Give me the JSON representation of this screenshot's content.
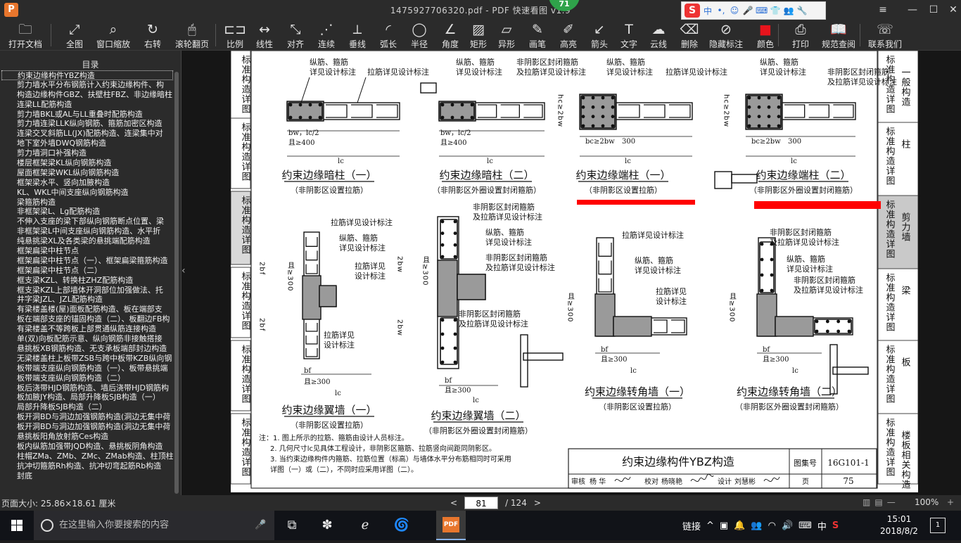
{
  "window": {
    "title": "1475927706320.pdf - PDF 快速看图 v1.9",
    "badge": "71",
    "logo_letter": "P",
    "min": "—",
    "restore": "☐",
    "close": "✕",
    "menu": "≡"
  },
  "ime": {
    "logo": "S",
    "lang": "中",
    "items": [
      "•,",
      "☺",
      "🎤",
      "⌨",
      "👕",
      "👥",
      "🔧"
    ]
  },
  "toolbar": [
    {
      "label": "打开文档",
      "icon": "folder-icon",
      "glyph": "🗀"
    },
    {
      "label": "全图",
      "icon": "fit-icon",
      "glyph": "⤢"
    },
    {
      "label": "窗口缩放",
      "icon": "zoom-icon",
      "glyph": "⌕"
    },
    {
      "label": "右转",
      "icon": "rotate-icon",
      "glyph": "↻"
    },
    {
      "label": "滚轮翻页",
      "icon": "mouse-icon",
      "glyph": "🖱"
    },
    {
      "label": "比例",
      "icon": "scale-icon",
      "glyph": "⊏⊐"
    },
    {
      "label": "线性",
      "icon": "linear-icon",
      "glyph": "↔"
    },
    {
      "label": "对齐",
      "icon": "aligned-icon",
      "glyph": "⤡"
    },
    {
      "label": "连续",
      "icon": "continuous-icon",
      "glyph": "⋰"
    },
    {
      "label": "垂线",
      "icon": "perpendicular-icon",
      "glyph": "⟂"
    },
    {
      "label": "弧长",
      "icon": "arc-icon",
      "glyph": "◜"
    },
    {
      "label": "半径",
      "icon": "radius-icon",
      "glyph": "◯"
    },
    {
      "label": "角度",
      "icon": "angle-icon",
      "glyph": "∠"
    },
    {
      "label": "矩形",
      "icon": "rect-icon",
      "glyph": "▨"
    },
    {
      "label": "异形",
      "icon": "shape-icon",
      "glyph": "▱"
    },
    {
      "label": "画笔",
      "icon": "pen-icon",
      "glyph": "✎"
    },
    {
      "label": "高亮",
      "icon": "highlight-icon",
      "glyph": "✐"
    },
    {
      "label": "箭头",
      "icon": "arrow-icon",
      "glyph": "↙"
    },
    {
      "label": "文字",
      "icon": "text-icon",
      "glyph": "T"
    },
    {
      "label": "云线",
      "icon": "cloud-icon",
      "glyph": "☁"
    },
    {
      "label": "删除",
      "icon": "eraser-icon",
      "glyph": "⌫"
    },
    {
      "label": "隐藏标注",
      "icon": "hide-icon",
      "glyph": "⊘"
    },
    {
      "label": "颜色",
      "icon": "color-icon",
      "glyph": "■",
      "color": "#e8141c"
    },
    {
      "label": "打印",
      "icon": "print-icon",
      "glyph": "⎙"
    },
    {
      "label": "规范查阅",
      "icon": "book-icon",
      "glyph": "📖"
    },
    {
      "label": "联系我们",
      "icon": "contact-icon",
      "glyph": "☏"
    }
  ],
  "sidebar": {
    "title": "目录",
    "items": [
      "约束边缘构件YBZ构造",
      "剪力墙水平分布钢筋计入约束边缘构件、构",
      "构造边缘构件GBZ、扶壁柱FBZ、非边缘暗柱",
      "连梁LL配筋构造",
      "剪力墙BKL或AL与LL重叠时配筋构造",
      "剪力墙连梁LLK纵向钢筋、箍筋加密区构造",
      "连梁交叉斜筋LL(JX)配筋构造、连梁集中对",
      "地下室外墙DWQ钢筋构造",
      "剪力墙洞口补强构造",
      "楼层框架梁KL纵向钢筋构造",
      "屋面框架梁WKL纵向钢筋构造",
      "框架梁水平、竖向加腋构造",
      "KL、WKL中间支座纵向钢筋构造",
      "梁箍筋构造",
      "非框架梁L、Lg配筋构造",
      "不伸入支座的梁下部纵向钢筋断点位置、梁",
      "非框架梁L中间支座纵向钢筋构造、水平折",
      "纯悬挑梁XL及各类梁的悬挑端配筋构造",
      "框架扁梁中柱节点",
      "框架扁梁中柱节点（一）、框架扁梁箍筋构造",
      "框架扁梁中柱节点（二）",
      "框支梁KZL、转换柱ZHZ配筋构造",
      "框支梁KZL上部墙体开洞部位加强做法、托",
      "井字梁JZL、JZL配筋构造",
      "有梁楼盖楼(屋)面板配筋构造、板在端部支",
      "板在端部支座的锚固构造（二）、板翻边FB构",
      "有梁楼盖不等跨板上部贯通纵筋连接构造",
      "单(双)向板配筋示意、纵向钢筋非接触搭接",
      "悬挑板XB钢筋构造、无支承板端部封边构造",
      "无梁楼盖柱上板带ZSB与跨中板带KZB纵向钢",
      "板带端支座纵向钢筋构造（一）、板带悬挑端",
      "板带端支座纵向钢筋构造（二）",
      "板后浇带HJD钢筋构造、墙后浇带HJD钢筋构",
      "板加腋JY构造、局部升降板SJB构造（一）",
      "局部升降板SJB构造（二）",
      "板开洞BD与洞边加强钢筋构造(洞边无集中荷",
      "板开洞BD与洞边加强钢筋构造(洞边无集中荷",
      "悬挑板阳角放射筋Ces构造",
      "板内纵筋加强带JQD构造、悬挑板阴角构造",
      "柱帽ZMa、ZMb、ZMc、ZMab构造、柱顶柱帽",
      "抗冲切箍筋Rh构造、抗冲切弯起筋Rb构造",
      "封底"
    ]
  },
  "drawing": {
    "side_tabs": [
      "标准构造详图",
      "标准构造详图",
      "标准构造详图",
      "标准构造详图",
      "标准构造详图",
      "标准构造详图"
    ],
    "right_tabs": [
      {
        "title": "标准构造详图",
        "sub": "一般构造"
      },
      {
        "title": "标准构造详图",
        "sub": "柱"
      },
      {
        "title": "标准构造详图",
        "sub": "剪力墙"
      },
      {
        "title": "标准构造详图",
        "sub": "梁"
      },
      {
        "title": "标准构造详图",
        "sub": "板"
      },
      {
        "title": "标准构造详图",
        "sub": "楼板相关构造"
      }
    ],
    "details": [
      {
        "title": "约束边缘暗柱（一）",
        "sub": "（非阴影区设置拉筋）"
      },
      {
        "title": "约束边缘暗柱（二）",
        "sub": "（非阴影区外圈设置封闭箍筋）"
      },
      {
        "title": "约束边缘端柱（一）",
        "sub": "（非阴影区设置拉筋）"
      },
      {
        "title": "约束边缘端柱（二）",
        "sub": "（非阴影区外圈设置封闭箍筋）"
      },
      {
        "title": "约束边缘翼墙（一）",
        "sub": "（非阴影区设置拉筋）"
      },
      {
        "title": "约束边缘翼墙（二）",
        "sub": "（非阴影区外圈设置封闭箍筋）"
      },
      {
        "title": "约束边缘转角墙（一）",
        "sub": "（非阴影区设置拉筋）"
      },
      {
        "title": "约束边缘转角墙（二）",
        "sub": "（非阴影区外圈设置封闭箍筋）"
      }
    ],
    "labels": {
      "zongjin": "纵筋、箍筋",
      "see_design": "详见设计标注",
      "lajin_see": "拉筋详见设计标注",
      "lajin": "拉筋详见",
      "lajin2": "设计标注",
      "fengbi": "非阴影区封闭箍筋",
      "fengbi2": "及拉筋详见设计标注",
      "bw_lc2": "bw，lc/2",
      "ge400": "且≥400",
      "ge300": "且≥300",
      "lc": "lc",
      "bc2bw": "bc≥2bw",
      "hc2bw": "hc≥2bw",
      "n300": "300",
      "bf": "bf",
      "bw": "bw",
      "two_bf": "2bf",
      "two_bw": "2bw"
    },
    "notes": [
      "注：1. 图上所示的拉筋、箍筋由设计人员标注。",
      "2. 几何尺寸lc见具体工程设计，非阴影区箍筋、拉筋竖向间距同阴影区。",
      "3. 当约束边缘构件内箍筋、拉筋位置（标高）与墙体水平分布筋相同时可采用",
      "详图（一）或（二），不同时应采用详图（二）。"
    ],
    "title_block": {
      "title": "约束边缘构件YBZ构造",
      "atlas_label": "图集号",
      "atlas_no": "16G101-1",
      "review": "审核",
      "review_name": "杨 华",
      "check": "校对",
      "check_name": "杨晓艳",
      "design": "设计",
      "design_name": "刘慧彬",
      "page_label": "页",
      "page_no": "75"
    },
    "annotation_color": "#ff0000"
  },
  "status": {
    "page_size": "页面大小: 25.86×18.61 厘米",
    "prev": "<",
    "next": ">",
    "current_page": "81",
    "total": "/ 124",
    "zoom": "100%",
    "zoom_minus": "—"
  },
  "taskbar": {
    "search_placeholder": "在这里输入你要搜索的内容",
    "tray_label": "链接",
    "ime": "中",
    "time": "15:01",
    "date": "2018/8/2",
    "notif": "1",
    "pdf_label": "PDF"
  }
}
